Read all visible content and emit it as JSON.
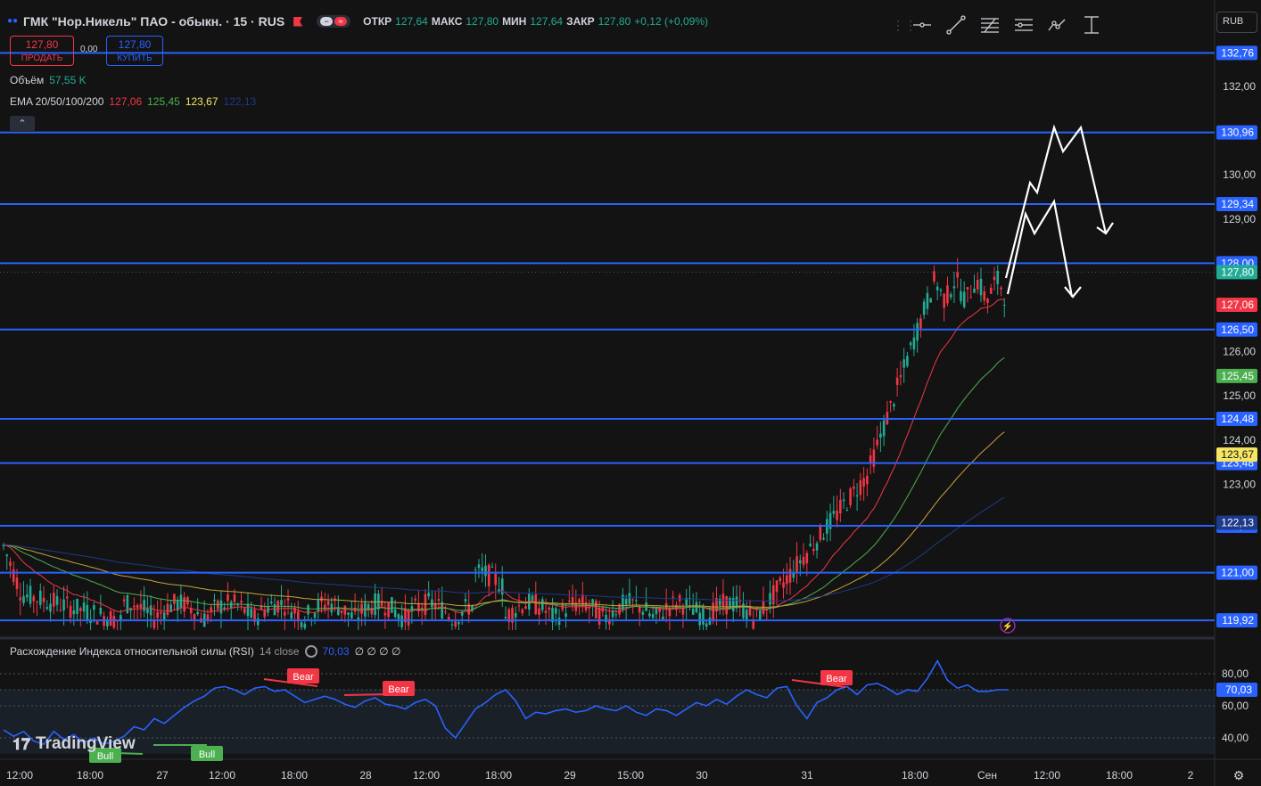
{
  "header": {
    "title": "ГМК \"Нор.Никель\" ПАО - обыкн. · 15 · RUS",
    "ohlc": [
      {
        "key": "ОТКР",
        "value": "127,64"
      },
      {
        "key": "МАКС",
        "value": "127,80"
      },
      {
        "key": "МИН",
        "value": "127,64"
      },
      {
        "key": "ЗАКР",
        "value": "127,80"
      }
    ],
    "change": "+0,12 (+0,09%)"
  },
  "toolbar": {
    "tools": [
      "horizontal-line-icon",
      "trend-line-icon",
      "fib-retracement-icon",
      "parallel-channel-icon",
      "path-icon",
      "price-range-icon"
    ]
  },
  "currency": "RUB",
  "trade": {
    "sell_price": "127,80",
    "sell_label": "ПРОДАТЬ",
    "buy_price": "127,80",
    "buy_label": "КУПИТЬ",
    "spread": "0,00"
  },
  "legend": {
    "volume_label": "Объём",
    "volume_value": "57,55 K",
    "ema_label": "EMA 20/50/100/200",
    "ema_values": [
      "127,06",
      "125,45",
      "123,67",
      "122,13"
    ]
  },
  "rsi_legend": {
    "label": "Расхождение Индекса относительной силы (RSI)",
    "params": "14 close",
    "value": "70,03",
    "extra": "∅ ∅ ∅ ∅"
  },
  "logo": "TradingView",
  "colors": {
    "up": "#22ab94",
    "down": "#f23645",
    "level": "#2962ff",
    "ema20": "#f23645",
    "ema50": "#4caf50",
    "ema100": "#cddc39",
    "ema200": "#1e3a8a",
    "rsi": "#2962ff"
  },
  "chart_data": {
    "type": "candlestick",
    "price_range": [
      119.7,
      133.0
    ],
    "price_ticks": [
      "132,00",
      "130,00",
      "129,00",
      "126,00",
      "125,00",
      "124,00",
      "123,00"
    ],
    "horizontal_levels": [
      {
        "value": 132.76,
        "label": "132,76"
      },
      {
        "value": 130.96,
        "label": "130,96"
      },
      {
        "value": 129.34,
        "label": "129,34"
      },
      {
        "value": 128.0,
        "label": "128,00"
      },
      {
        "value": 126.5,
        "label": "126,50"
      },
      {
        "value": 124.48,
        "label": "124,48"
      },
      {
        "value": 123.48,
        "label": "123,48"
      },
      {
        "value": 122.06,
        "label": "122,06"
      },
      {
        "value": 121.0,
        "label": "121,00"
      },
      {
        "value": 119.92,
        "label": "119,92"
      }
    ],
    "price_badges": [
      {
        "value": 127.8,
        "label": "127,80",
        "color": "#22ab94"
      },
      {
        "value": 127.06,
        "label": "127,06",
        "color": "#f23645"
      },
      {
        "value": 125.45,
        "label": "125,45",
        "color": "#4caf50"
      },
      {
        "value": 123.67,
        "label": "123,67",
        "color": "#f5e663"
      },
      {
        "value": 122.13,
        "label": "122,13",
        "color": "#1e3a8a"
      }
    ],
    "time_labels": [
      "12:00",
      "18:00",
      "27",
      "12:00",
      "18:00",
      "28",
      "12:00",
      "18:00",
      "29",
      "15:00",
      "30",
      "31",
      "18:00",
      "Сен",
      "12:00",
      "18:00",
      "2"
    ],
    "rsi": {
      "ticks": [
        "80,00",
        "60,00",
        "40,00"
      ],
      "current": "70,03",
      "divergence_labels": [
        "Bear",
        "Bear",
        "Bear",
        "Bull",
        "Bull"
      ],
      "values": [
        45,
        41,
        44,
        38,
        36,
        44,
        39,
        42,
        37,
        40,
        36,
        38,
        41,
        47,
        45,
        52,
        49,
        54,
        59,
        63,
        66,
        71,
        72,
        70,
        67,
        71,
        72,
        69,
        70,
        66,
        62,
        64,
        66,
        64,
        61,
        59,
        63,
        65,
        61,
        60,
        58,
        62,
        64,
        60,
        46,
        40,
        49,
        58,
        62,
        67,
        70,
        63,
        52,
        56,
        55,
        57,
        58,
        56,
        57,
        60,
        58,
        57,
        60,
        56,
        54,
        58,
        57,
        54,
        58,
        62,
        60,
        64,
        61,
        66,
        70,
        67,
        65,
        71,
        72,
        60,
        52,
        62,
        65,
        70,
        72,
        67,
        73,
        74,
        71,
        67,
        70,
        69,
        77,
        88,
        76,
        71,
        73,
        69,
        69,
        70,
        70
      ]
    },
    "projection_note": "hand-drawn zigzag arrows"
  }
}
